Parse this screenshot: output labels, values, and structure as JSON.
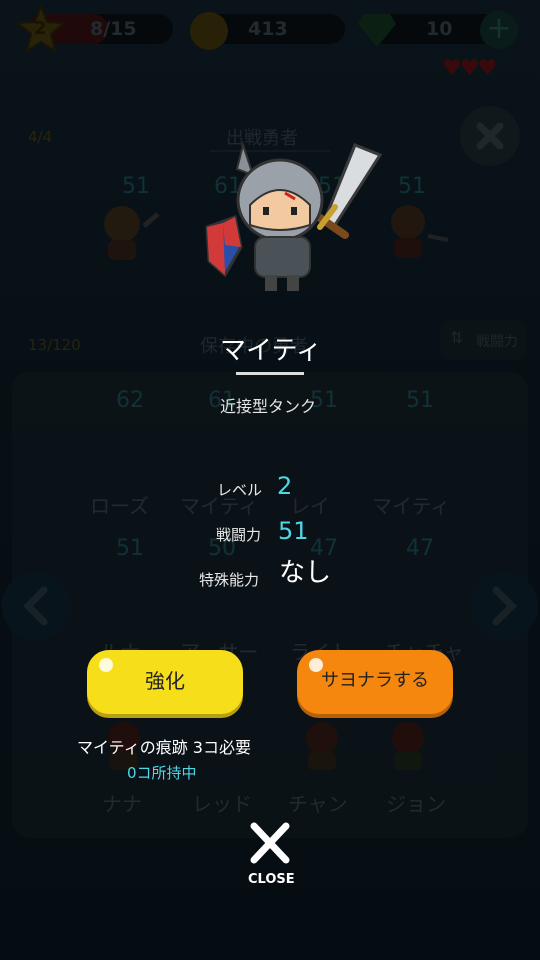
{
  "top": {
    "level": "2",
    "stamina": "8/15",
    "coins": "413",
    "gems": "10"
  },
  "sortie": {
    "count": "4/4",
    "title": "出戦勇者",
    "powers": [
      "51",
      "61",
      "51",
      "51"
    ]
  },
  "storage": {
    "count": "13/120",
    "title": "保存中の勇者",
    "sort_label": "戦闘力"
  },
  "grid": {
    "row1_powers": [
      "62",
      "61",
      "51",
      "51"
    ],
    "row1_names": [
      "ローズ",
      "マイティ",
      "レイ",
      "マイティ"
    ],
    "row2_powers": [
      "51",
      "50",
      "47",
      "47"
    ],
    "row2_names": [
      "ルナ",
      "アーサー",
      "ライト",
      "チャチャ"
    ],
    "row3_names": [
      "ナナ",
      "レッド",
      "チャン",
      "ジョン"
    ]
  },
  "detail": {
    "hero_name": "マイティ",
    "role": "近接型タンク",
    "level_label": "レベル",
    "level_value": "2",
    "power_label": "戦闘力",
    "power_value": "51",
    "ability_label": "特殊能力",
    "ability_value": "なし",
    "upgrade_button": "強化",
    "farewell_button": "サヨナラする",
    "requirement": "マイティの痕跡 3コ必要",
    "owned": "0コ所持中",
    "close_label": "CLOSE"
  },
  "colors": {
    "accent_cyan": "#4ed8e6",
    "upgrade_yellow": "#f7de1a",
    "farewell_orange": "#f5870f"
  }
}
